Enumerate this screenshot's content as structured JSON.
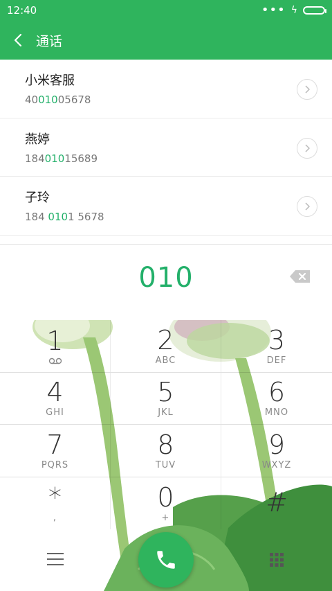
{
  "status_bar": {
    "time": "12:40",
    "dots": "•••",
    "charging_symbol": "ϟ",
    "icons": [
      "overflow-dots-icon",
      "charging-icon",
      "battery-icon"
    ]
  },
  "header": {
    "title": "通话",
    "back_icon": "chevron-left-icon"
  },
  "contacts": [
    {
      "name": "小米客服",
      "number_before": "40",
      "number_match": "010",
      "number_after": "05678"
    },
    {
      "name": "燕婷",
      "number_before": "184",
      "number_match": "010",
      "number_after": "15689"
    },
    {
      "name": "子玲",
      "number_before": "184 ",
      "number_match": "010",
      "number_after": "1 5678"
    }
  ],
  "entry": {
    "value": "010",
    "backspace_icon": "backspace-icon"
  },
  "dialpad": [
    [
      {
        "digit": "1",
        "letters": ""
      },
      {
        "digit": "2",
        "letters": "ABC"
      },
      {
        "digit": "3",
        "letters": "DEF"
      }
    ],
    [
      {
        "digit": "4",
        "letters": "GHI"
      },
      {
        "digit": "5",
        "letters": "JKL"
      },
      {
        "digit": "6",
        "letters": "MNO"
      }
    ],
    [
      {
        "digit": "7",
        "letters": "PQRS"
      },
      {
        "digit": "8",
        "letters": "TUV"
      },
      {
        "digit": "9",
        "letters": "WXYZ"
      }
    ],
    [
      {
        "digit": "*",
        "letters": ","
      },
      {
        "digit": "0",
        "letters": "+"
      },
      {
        "digit": "#",
        "letters": ""
      }
    ]
  ],
  "bottom": {
    "menu_icon": "menu-icon",
    "call_icon": "phone-icon",
    "keypad_icon": "keypad-grid-icon"
  },
  "colors": {
    "accent": "#2fb45d",
    "highlight": "#23b06a"
  }
}
